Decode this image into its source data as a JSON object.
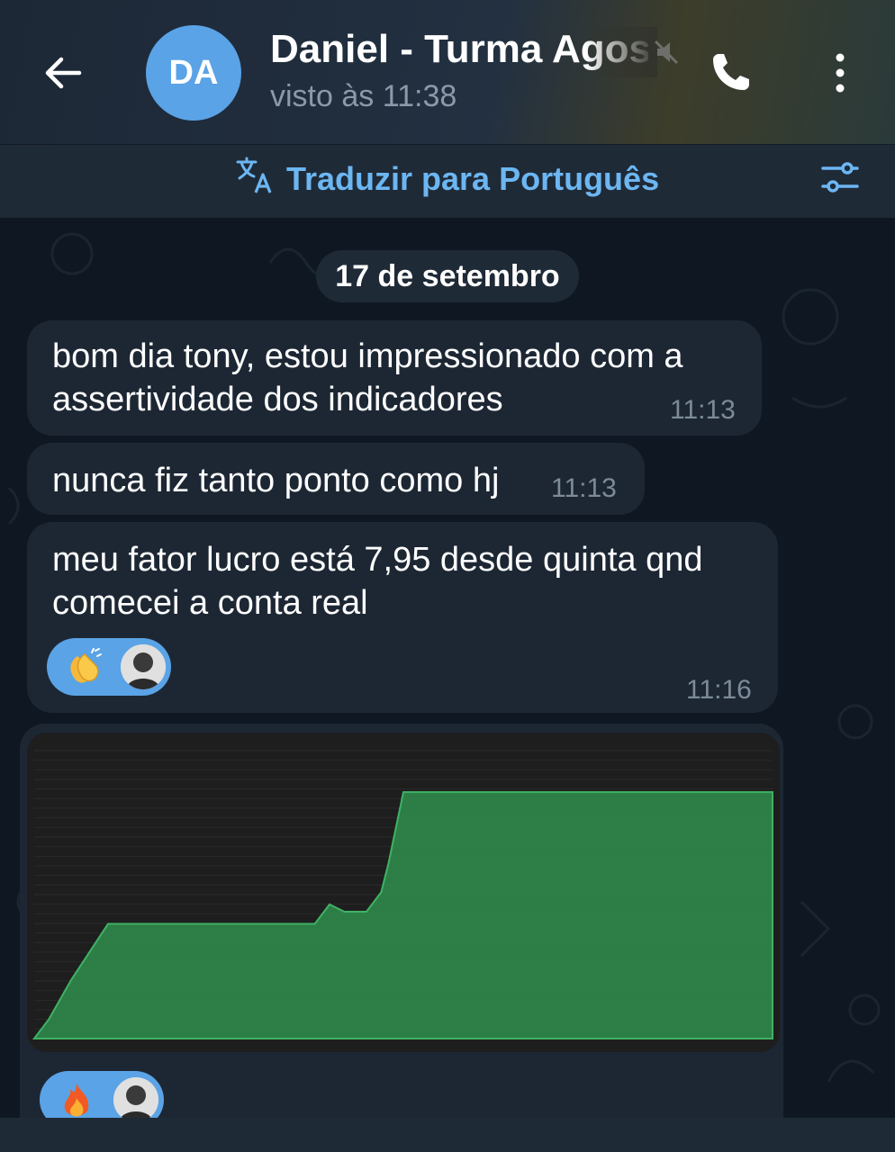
{
  "header": {
    "avatar_initials": "DA",
    "avatar_color": "#5aa3e6",
    "contact_name": "Daniel - Turma Agos",
    "status": "visto às 11:38",
    "icons": [
      "back-arrow-icon",
      "mute-icon",
      "phone-icon",
      "more-vertical-icon"
    ]
  },
  "translate_bar": {
    "label": "Traduzir para Português",
    "accent": "#6cb6f2",
    "icons": [
      "translate-icon",
      "settings-sliders-icon"
    ]
  },
  "chat": {
    "date": "17 de setembro",
    "messages": [
      {
        "lines": [
          "bom dia tony, estou impressionado com a",
          "assertividade dos indicadores"
        ],
        "time": "11:13"
      },
      {
        "lines": [
          "nunca fiz tanto ponto como hj"
        ],
        "time": "11:13"
      },
      {
        "lines": [
          "meu fator lucro está 7,95 desde quinta qnd",
          "comecei a conta real"
        ],
        "time": "11:16",
        "reaction": "clapping-hands-emoji"
      }
    ],
    "image_message": {
      "reaction": "fire-emoji",
      "bubble_color": "#1d2734",
      "reaction_color": "#5aa3e6"
    }
  },
  "chart_data": {
    "type": "area",
    "color": "#2f8f4e",
    "background": "#1e1e1e",
    "grid": true,
    "x": [
      0,
      2,
      5,
      10,
      15,
      20,
      25,
      30,
      35,
      38,
      40,
      42,
      45,
      47,
      48,
      50,
      55,
      60,
      62,
      64,
      65,
      67,
      70,
      72,
      74,
      75,
      77,
      80,
      85,
      90,
      92,
      93,
      94,
      95,
      98,
      100
    ],
    "values": [
      0,
      8,
      24,
      47,
      47,
      47,
      47,
      47,
      47,
      47,
      55,
      52,
      52,
      60,
      72,
      101,
      101,
      101,
      101,
      101,
      101,
      101,
      101,
      101,
      101,
      101,
      101,
      101,
      101,
      101,
      101,
      101,
      101,
      101,
      101,
      101
    ]
  }
}
